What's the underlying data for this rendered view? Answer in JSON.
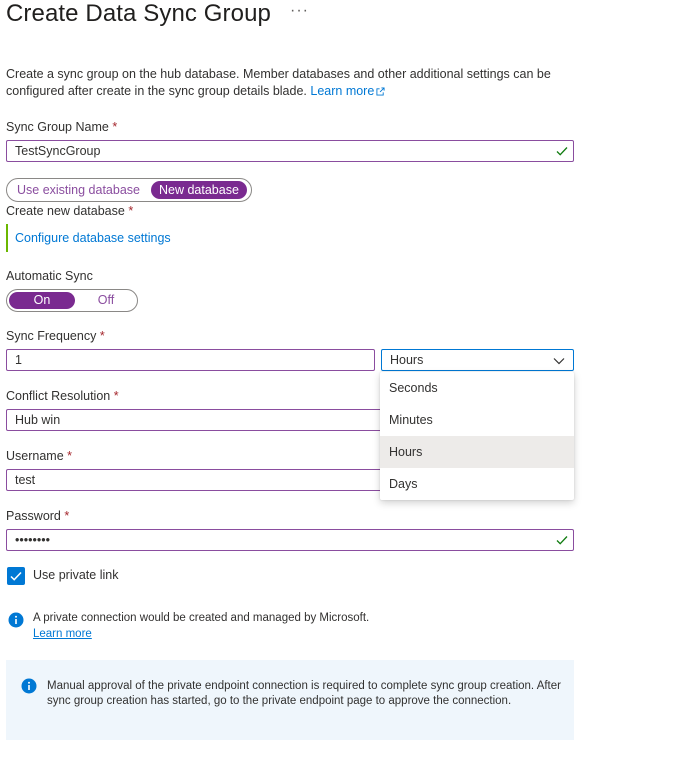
{
  "header": {
    "title": "Create Data Sync Group",
    "more_label": "···"
  },
  "intro": {
    "text": "Create a sync group on the hub database. Member databases and other additional settings can be configured after create in the sync group details blade.",
    "learn_more": "Learn more"
  },
  "sync_group_name": {
    "label": "Sync Group Name",
    "required_mark": "*",
    "value": "TestSyncGroup"
  },
  "database_choice": {
    "option_existing": "Use existing database",
    "option_new": "New database",
    "selected": "New database"
  },
  "create_new_database": {
    "label": "Create new database",
    "required_mark": "*",
    "configure_link": "Configure database settings"
  },
  "automatic_sync": {
    "label": "Automatic Sync",
    "on_label": "On",
    "off_label": "Off",
    "selected": "On"
  },
  "sync_frequency": {
    "label": "Sync Frequency",
    "required_mark": "*",
    "value": "1",
    "unit_selected": "Hours",
    "unit_options": [
      "Seconds",
      "Minutes",
      "Hours",
      "Days"
    ]
  },
  "conflict_resolution": {
    "label": "Conflict Resolution",
    "required_mark": "*",
    "value": "Hub win"
  },
  "username": {
    "label": "Username",
    "required_mark": "*",
    "value": "test"
  },
  "password": {
    "label": "Password",
    "required_mark": "*",
    "value": "••••••••"
  },
  "private_link": {
    "label": "Use private link",
    "checked": true
  },
  "private_info": {
    "text": "A private connection would be created and managed by Microsoft.",
    "learn_more": "Learn more"
  },
  "approval_info": {
    "text": "Manual approval of the private endpoint connection is required to complete sync group creation. After sync group creation has started, go to the private endpoint page to approve the connection."
  },
  "colors": {
    "accent_purple": "#8a4d9f",
    "selected_purple": "#7a2a90",
    "link_blue": "#0078d4",
    "success_green": "#107c10",
    "required_red": "#a4262c"
  }
}
